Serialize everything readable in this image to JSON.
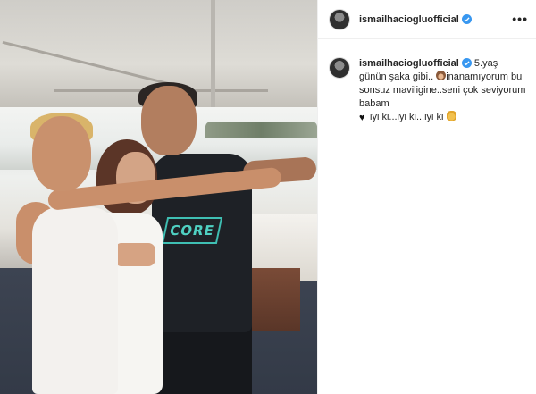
{
  "header": {
    "username": "ismailhaciogluofficial",
    "more_label": "•••"
  },
  "caption": {
    "username": "ismailhaciogluofficial",
    "text_1": "5.yaş günün şaka gibi..",
    "text_2": "inanamıyorum bu sonsuz maviligine..seni çok seviyorum babam",
    "text_3": "iyi ki...iyi ki...iyi ki",
    "emoji_1": "see-no-evil-monkey",
    "emoji_2": "black-heart",
    "emoji_3": "folded-hands"
  },
  "photo": {
    "shirt_logo": "CORE"
  },
  "colors": {
    "verified": "#3897f0",
    "text": "#262626",
    "border": "#efefef"
  }
}
